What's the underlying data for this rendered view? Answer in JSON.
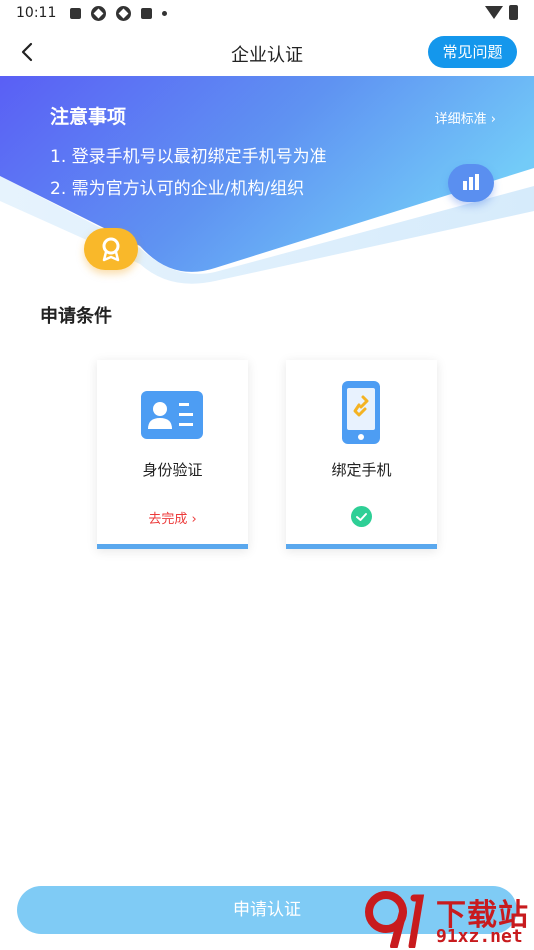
{
  "status_bar": {
    "time": "10:11"
  },
  "nav": {
    "title": "企业认证",
    "faq_label": "常见问题"
  },
  "notice": {
    "title": "注意事项",
    "more_label": "详细标准 ›",
    "lines": [
      "1. 登录手机号以最初绑定手机号为准",
      "2. 需为官方认可的企业/机构/组织"
    ]
  },
  "conditions": {
    "title": "申请条件",
    "items": [
      {
        "label": "身份验证",
        "status": "去完成 ›",
        "icon": "id-card-icon"
      },
      {
        "label": "绑定手机",
        "status": "",
        "icon": "phone-link-icon",
        "done_icon": "check-icon"
      }
    ]
  },
  "apply_button": {
    "label": "申请认证"
  },
  "watermark": {
    "big": "下载站",
    "small": "91xz.net"
  },
  "colors": {
    "primary": "#1497ec",
    "banner_start": "#5a63f5",
    "banner_end": "#6ecaf7",
    "apply": "#7fcbf5",
    "warn": "#ec3a3a",
    "success": "#2ecf96"
  }
}
